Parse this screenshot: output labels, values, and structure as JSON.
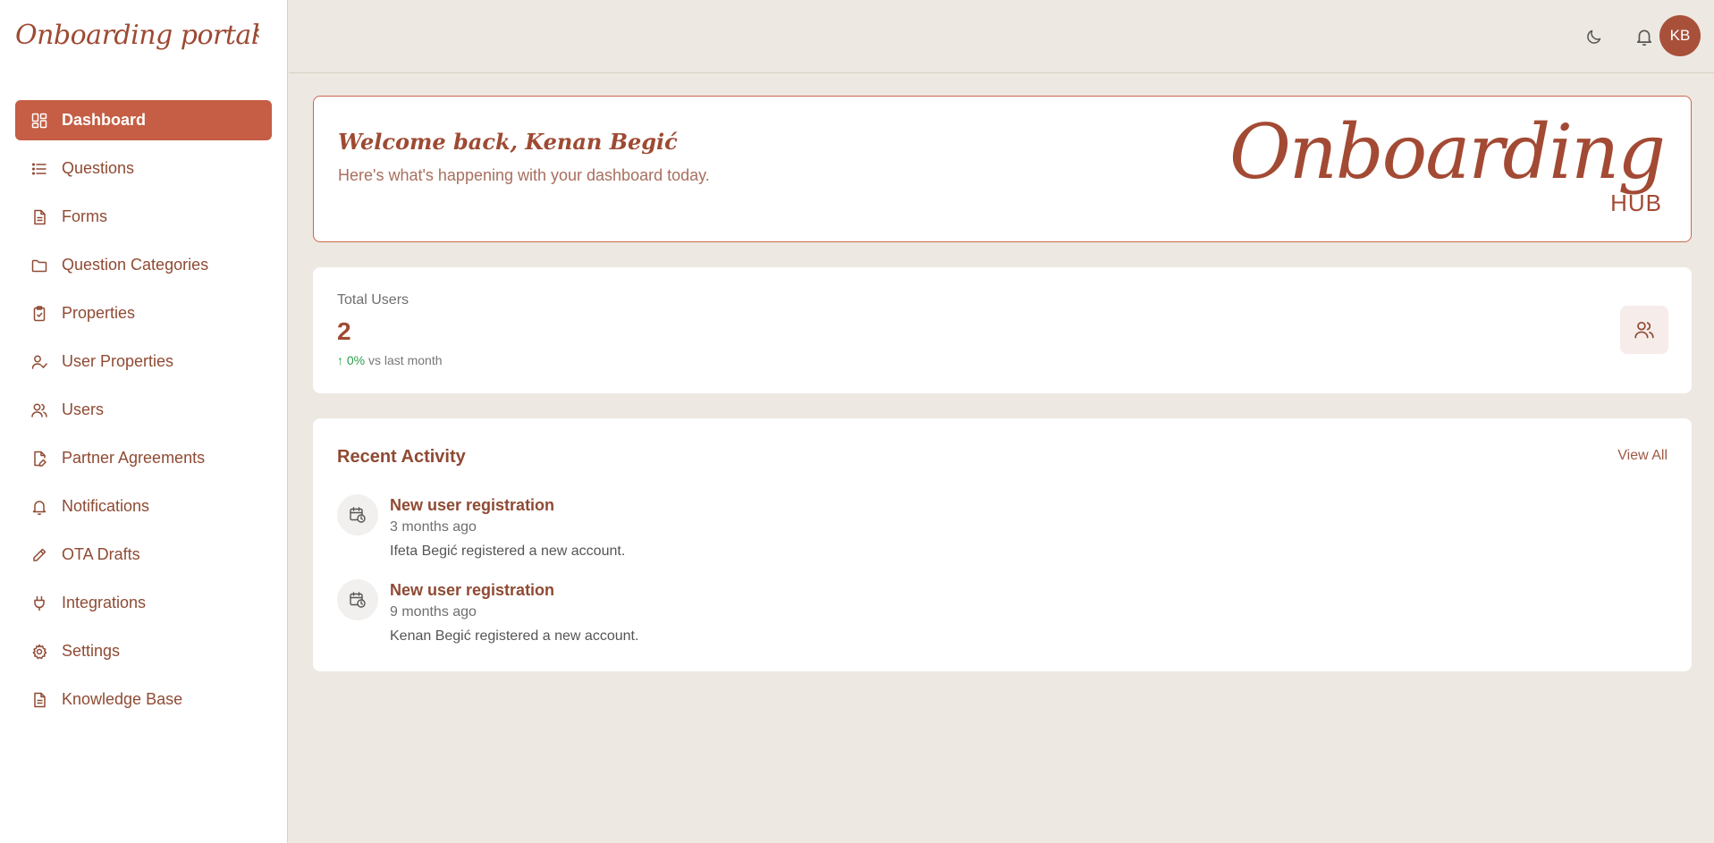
{
  "app": {
    "brand": "Onboarding portal"
  },
  "sidebar": {
    "items": [
      {
        "label": "Dashboard",
        "icon": "dashboard-icon",
        "active": true
      },
      {
        "label": "Questions",
        "icon": "list-icon"
      },
      {
        "label": "Forms",
        "icon": "document-icon"
      },
      {
        "label": "Question Categories",
        "icon": "folder-icon"
      },
      {
        "label": "Properties",
        "icon": "clipboard-check-icon"
      },
      {
        "label": "User Properties",
        "icon": "user-check-icon"
      },
      {
        "label": "Users",
        "icon": "users-icon"
      },
      {
        "label": "Partner Agreements",
        "icon": "edit-document-icon"
      },
      {
        "label": "Notifications",
        "icon": "bell-icon"
      },
      {
        "label": "OTA Drafts",
        "icon": "pencil-icon"
      },
      {
        "label": "Integrations",
        "icon": "plug-icon"
      },
      {
        "label": "Settings",
        "icon": "gear-icon"
      },
      {
        "label": "Knowledge Base",
        "icon": "document-icon"
      }
    ]
  },
  "header": {
    "avatar_initials": "KB"
  },
  "welcome": {
    "title": "Welcome back, Kenan Begić",
    "subtitle": "Here's what's happening with your dashboard today.",
    "logo_main": "Onboarding",
    "logo_sub": "HUB"
  },
  "stats": {
    "label": "Total Users",
    "value": "2",
    "change": "↑ 0%",
    "change_suffix": "vs last month"
  },
  "activity": {
    "title": "Recent Activity",
    "view_all": "View All",
    "items": [
      {
        "title": "New user registration",
        "time": "3 months ago",
        "description": "Ifeta Begić registered a new account."
      },
      {
        "title": "New user registration",
        "time": "9 months ago",
        "description": "Kenan Begić registered a new account."
      }
    ]
  },
  "colors": {
    "accent": "#C55E44",
    "brand": "#9E4A33",
    "background": "#EDE8E1",
    "positive": "#2DA04A"
  }
}
